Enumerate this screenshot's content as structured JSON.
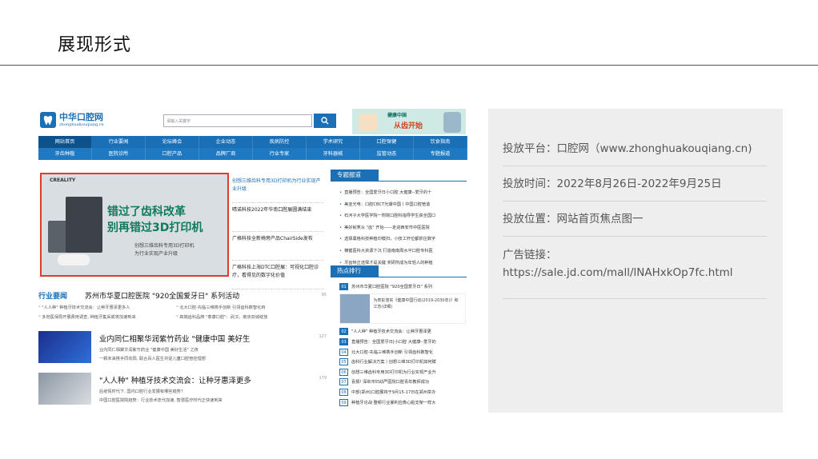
{
  "slide": {
    "title": "展现形式"
  },
  "site": {
    "logo_name": "中华口腔网",
    "logo_url": "zhonghuakouqiang.cn",
    "search_placeholder": "请输入关键字",
    "banner_line1": "健康中国",
    "banner_line2": "从齿开始",
    "nav_row1": [
      "网站首页",
      "行业要闻",
      "论坛峰会",
      "企业动态",
      "疾病防控",
      "学术研究",
      "口腔保健",
      "饮食指南"
    ],
    "nav_row2": [
      "牙齿种植",
      "医院诊所",
      "口腔产品",
      "品牌厂商",
      "行业专家",
      "牙科器械",
      "监管动态",
      "专题报道"
    ],
    "focus": {
      "brand": "CREALITY",
      "headline1": "错过了齿科改革",
      "headline2": "别再错过3D打印机",
      "sub1": "创想三维齿科专用3D打印机",
      "sub2": "为行业实现产业升级"
    },
    "focus_list": [
      "创想三维齿科专用3D打印机为行业实现产业升级",
      "晴诺科技2022年华南口腔展圆满结束",
      "广格科技全新椅旁产品ChairSide发布",
      "广格科技上海DTC口腔展：可视化口腔诊疗，看得见的数字化价值"
    ],
    "topics_header": "专题报道",
    "topics": [
      "直播预告：全国爱牙日小口腔 大健康--爱牙的十",
      "美亚光电：口腔CBCT光爆中国丨中国口腔管造",
      "石河子大学医学院一附院口腔科指导学生获全国口",
      "美好就笑从 \"齿\" 开始——走进西安市中医医院",
      "选择黑格科技种植印模扫，小技工杆位都抓住数字",
      "横健医科大资源下沉 打造南南周水平口腔专科医",
      "牙齿矫正选择才是关键 奖研所成为年轻人的种植"
    ],
    "hot_header": "热点排行",
    "hot_first": "苏州市华夏口腔医院 \"920全国爱牙日\" 系列",
    "hot_feature": "为表彰落实《健康中国行动(2019-2030年)》和江苏(详细)",
    "hot_items": [
      {
        "n": "02",
        "t": "\"人人种\" 种植牙技术交流会：让种牙惠泽更"
      },
      {
        "n": "03",
        "t": "直播预告：全国爱牙日|小口腔 大健康--爱牙的"
      },
      {
        "n": "04",
        "t": "北大口腔-先临三维携手创新 引领齿科数智化"
      },
      {
        "n": "05",
        "t": "齿科行业解决方案丨创想三维3D打印机如何赋"
      },
      {
        "n": "06",
        "t": "创想三维齿科专用3D打印机为行业实现产业升"
      },
      {
        "n": "07",
        "t": "喜报! 深圳市妇幼严医院口腔青年教师成功"
      },
      {
        "n": "08",
        "t": "中部(郑州)口腔展将于9月15-17日在郑州举办"
      },
      {
        "n": "09",
        "t": "种植牙论战 整顿行业暴利应像心脏支架一样大"
      }
    ],
    "news_tag": "行业要闻",
    "news_top_title": "苏州市华夏口腔医院 \"920全国爱牙日\" 系列活动",
    "news_top_count": "95",
    "news_top_subs": [
      "\"人人种\" 种植牙技术交流会：让种牙惠泽更多人",
      "北大口腔-先临三维携手创新 引领齿科数智化转",
      "多地医保局开展费用调查, 种植牙集采或将加速到来",
      "高端齿科品牌 \"泰康口腔\"：武汉、南京双城绽放"
    ],
    "news": [
      {
        "title": "业内同仁相聚华润紫竹药业 \"健康中国 美好生",
        "count": "127",
        "l1": "业内同仁相聚华润紫竹药业 \"健康中国 美好生活\" 之夜",
        "l2": "一颗未来携手同向阳, 联合百人医生共促儿童口腔管控理想"
      },
      {
        "title": "\"人人种\" 种植牙技术交流会：让种牙惠泽更多",
        "count": "179",
        "l1": "后疫情时代下, 国内口腔行业发展有哪些趋势?",
        "l2": "中国口腔医院院趋势：行业技术迭代加速, 智慧医疗时代正快速到来"
      }
    ]
  },
  "info": {
    "platform_label": "投放平台：",
    "platform_value": "口腔网（www.zhonghuakouqiang.cn)",
    "time_label": "投放时间：",
    "time_value": "2022年8月26日-2022年9月25日",
    "position_label": "投放位置：",
    "position_value": "网站首页焦点图一",
    "link_label": "广告链接：",
    "link_value": "https://sale.jd.com/mall/lNAHxkOp7fc.html"
  },
  "colors": {
    "brand_blue": "#1a6fb5",
    "focus_border": "#e03b2e",
    "headline_green": "#0f7a5e",
    "info_bg": "#eeeeee"
  }
}
